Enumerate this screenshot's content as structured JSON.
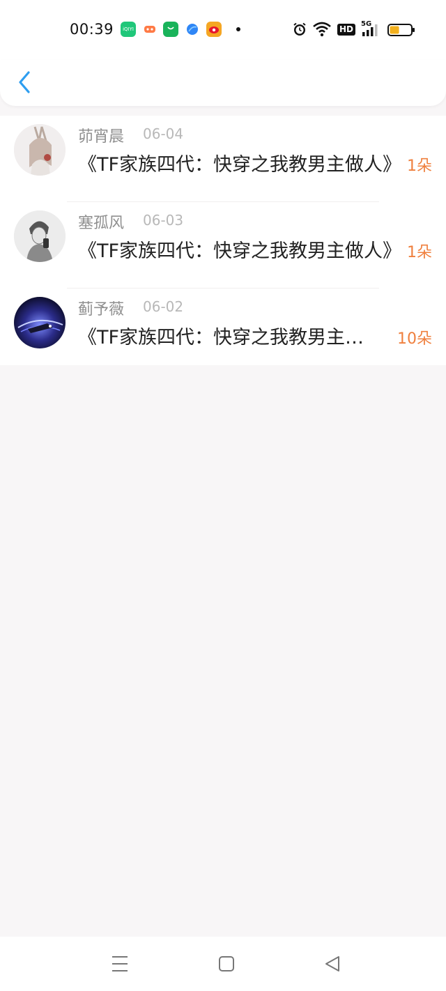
{
  "status_bar": {
    "time": "00:39",
    "notification_apps": [
      {
        "name": "iqiyi-icon",
        "label": "iQIYI",
        "color": "#20c77a"
      },
      {
        "name": "game-icon",
        "label": "",
        "color": "#ff7a45"
      },
      {
        "name": "store-icon",
        "label": "",
        "color": "#19b35a"
      },
      {
        "name": "browser-icon",
        "label": "",
        "color": "#2f86f6"
      },
      {
        "name": "weibo-icon",
        "label": "",
        "color": "#f5a623"
      }
    ],
    "network": "5G",
    "hd_label": "HD",
    "battery_level_percent": 45,
    "battery_color": "#f2b01e"
  },
  "header": {
    "back_icon": "chevron-left-icon",
    "accent_color": "#2e9ef0"
  },
  "gifts": [
    {
      "avatar_icon": "avatar-anime-girl",
      "name": "茆宵晨",
      "date": "06-04",
      "title": "《TF家族四代：快穿之我教男主做人》",
      "amount": "1朵"
    },
    {
      "avatar_icon": "avatar-sketch-boy",
      "name": "塞孤风",
      "date": "06-03",
      "title": "《TF家族四代：快穿之我教男主做人》",
      "amount": "1朵"
    },
    {
      "avatar_icon": "avatar-night-car",
      "name": "蓟予薇",
      "date": "06-02",
      "title": "《TF家族四代：快穿之我教男主做人》",
      "amount": "10朵"
    }
  ],
  "colors": {
    "amount": "#ef7f3d",
    "name": "#8f8f8f",
    "date": "#b8b8b8"
  },
  "bottom_nav": [
    "menu-icon",
    "home-square-icon",
    "back-triangle-icon"
  ]
}
